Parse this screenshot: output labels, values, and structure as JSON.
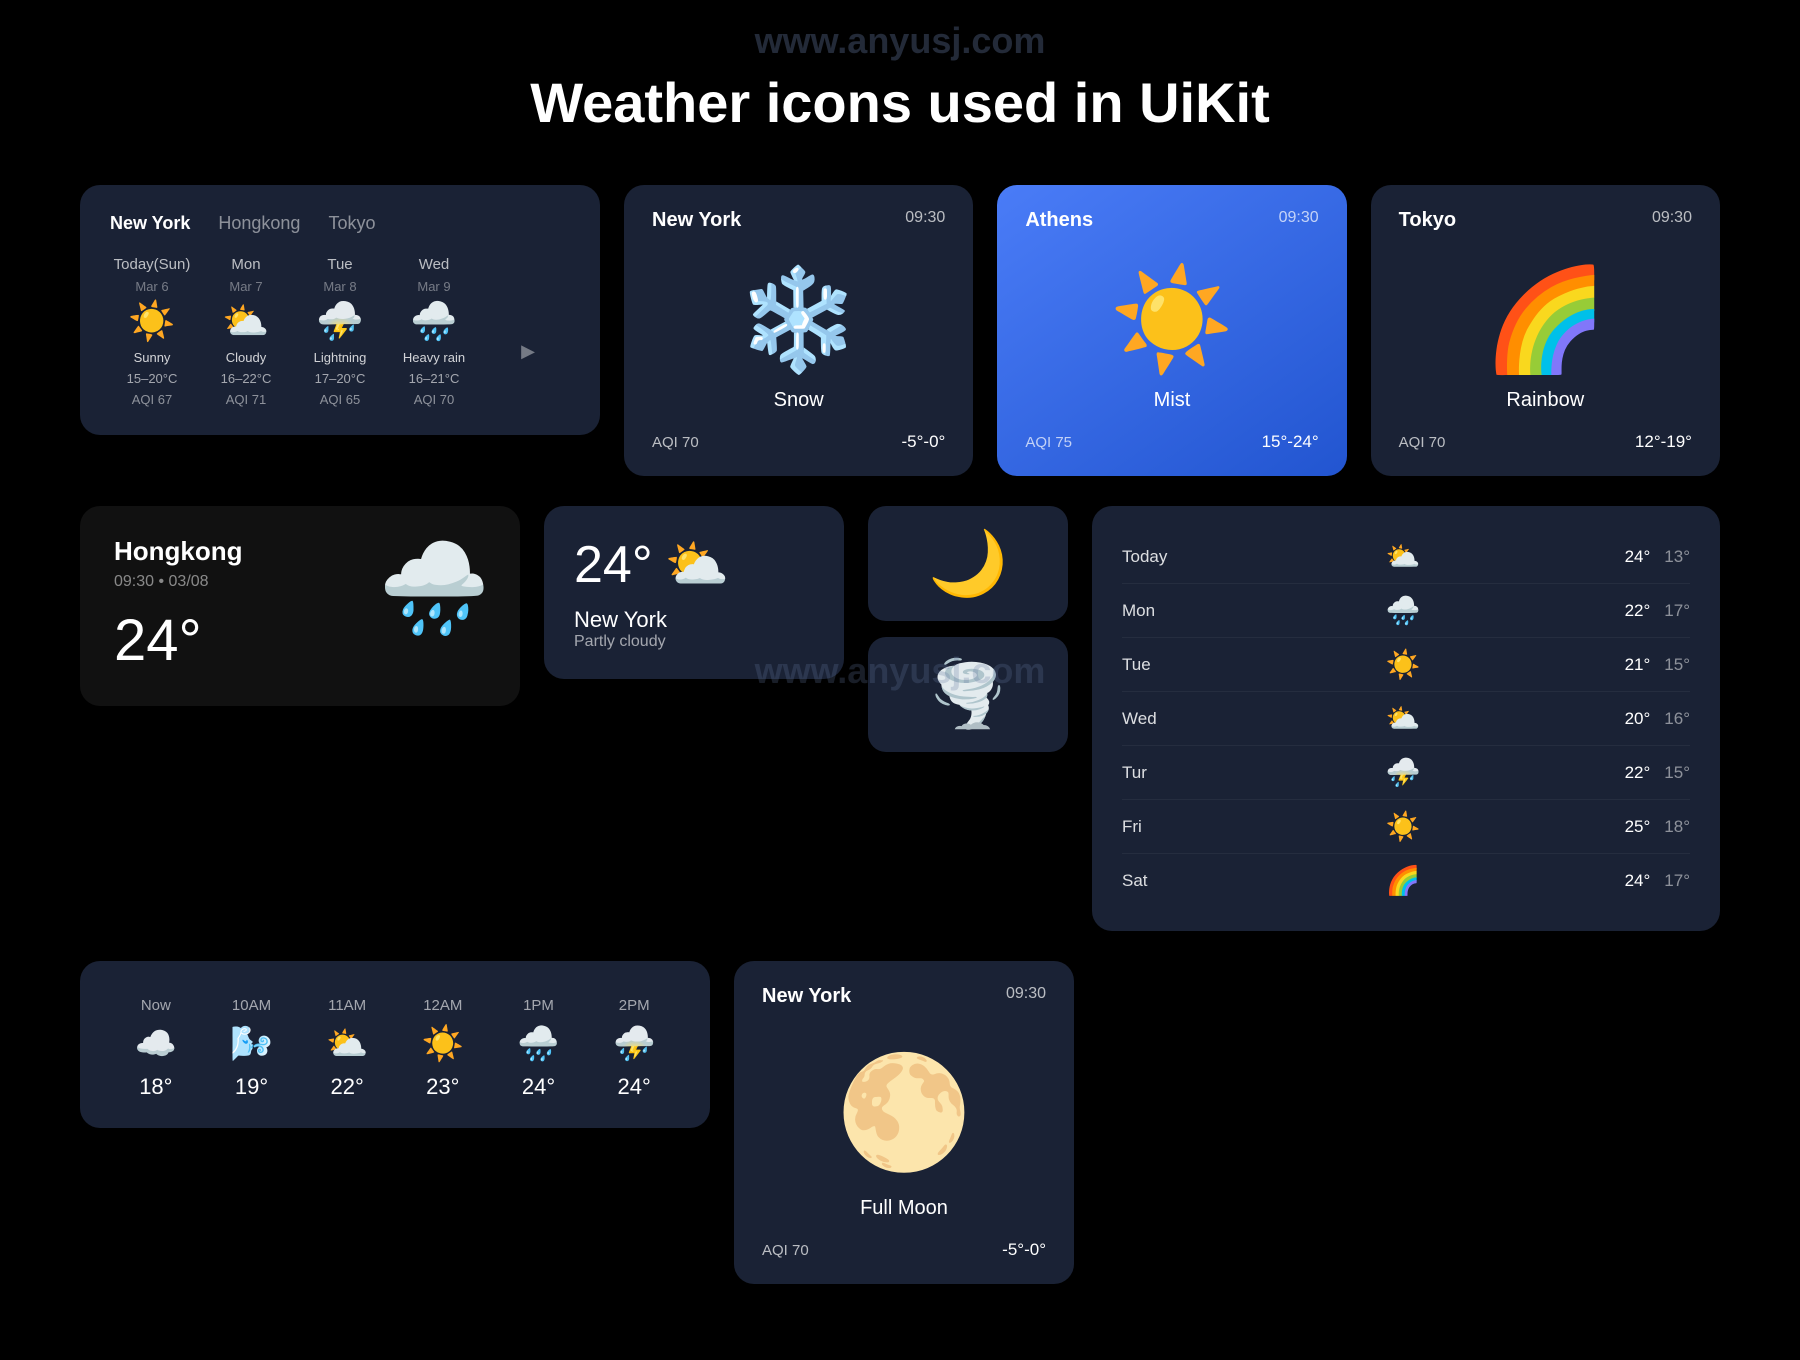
{
  "watermark": "www.anyusj.com",
  "title": "Weather icons used in UiKit",
  "row1": {
    "multi_city": {
      "tabs": [
        "New York",
        "Hongkong",
        "Tokyo"
      ],
      "active_tab": 0,
      "days": [
        {
          "label": "Today(Sun)",
          "date": "Mar 6",
          "icon": "☀️",
          "condition": "Sunny",
          "temp": "15–20°C",
          "aqi": "AQI 67"
        },
        {
          "label": "Mon",
          "date": "Mar 7",
          "icon": "⛅",
          "condition": "Cloudy",
          "temp": "16–22°C",
          "aqi": "AQI 71"
        },
        {
          "label": "Tue",
          "date": "Mar 8",
          "icon": "⛈️",
          "condition": "Lightning",
          "temp": "17–20°C",
          "aqi": "AQI 65"
        },
        {
          "label": "Wed",
          "date": "Mar 9",
          "icon": "🌧️",
          "condition": "Heavy rain",
          "temp": "16–21°C",
          "aqi": "AQI 70"
        }
      ]
    },
    "cards": [
      {
        "city": "New York",
        "time": "09:30",
        "icon": "❄️",
        "condition": "Snow",
        "aqi": "AQI 70",
        "temp": "-5°-0°",
        "bg": "dark",
        "icon_emoji": "❄️"
      },
      {
        "city": "Athens",
        "time": "09:30",
        "icon": "☀️",
        "condition": "Mist",
        "aqi": "AQI 75",
        "temp": "15°-24°",
        "bg": "blue",
        "icon_emoji": "☀️"
      },
      {
        "city": "Tokyo",
        "time": "09:30",
        "icon": "🌈",
        "condition": "Rainbow",
        "aqi": "AQI 70",
        "temp": "12°-19°",
        "bg": "dark",
        "icon_emoji": "🌈"
      }
    ]
  },
  "row2": {
    "hk": {
      "city": "Hongkong",
      "subtitle": "09:30 • 03/08",
      "temp": "24°",
      "icon": "🌧️"
    },
    "partly_cloudy": {
      "temp": "24°",
      "city": "New York",
      "condition": "Partly cloudy"
    },
    "icon_cards": [
      "🌙",
      "🌪️"
    ],
    "weekly": {
      "rows": [
        {
          "day": "Today",
          "icon": "⛅",
          "hi": "24°",
          "lo": "13°"
        },
        {
          "day": "Mon",
          "icon": "🌧️",
          "hi": "22°",
          "lo": "17°"
        },
        {
          "day": "Tue",
          "icon": "☀️",
          "hi": "21°",
          "lo": "15°"
        },
        {
          "day": "Wed",
          "icon": "⛅",
          "hi": "20°",
          "lo": "16°"
        },
        {
          "day": "Tur",
          "icon": "⛈️",
          "hi": "22°",
          "lo": "15°"
        },
        {
          "day": "Fri",
          "icon": "☀️",
          "hi": "25°",
          "lo": "18°"
        },
        {
          "day": "Sat",
          "icon": "🌈",
          "hi": "24°",
          "lo": "17°"
        }
      ]
    }
  },
  "row3": {
    "hourly": {
      "cols": [
        {
          "label": "Now",
          "icon": "☁️",
          "temp": "18°"
        },
        {
          "label": "10AM",
          "icon": "🌬️",
          "temp": "19°"
        },
        {
          "label": "11AM",
          "icon": "⛅",
          "temp": "22°"
        },
        {
          "label": "12AM",
          "icon": "☀️",
          "temp": "23°"
        },
        {
          "label": "1PM",
          "icon": "🌧️",
          "temp": "24°"
        },
        {
          "label": "2PM",
          "icon": "⛈️",
          "temp": "24°"
        }
      ]
    },
    "moon": {
      "city": "New York",
      "time": "09:30",
      "label": "Full Moon",
      "aqi": "AQI 70",
      "temp": "-5°-0°"
    }
  }
}
